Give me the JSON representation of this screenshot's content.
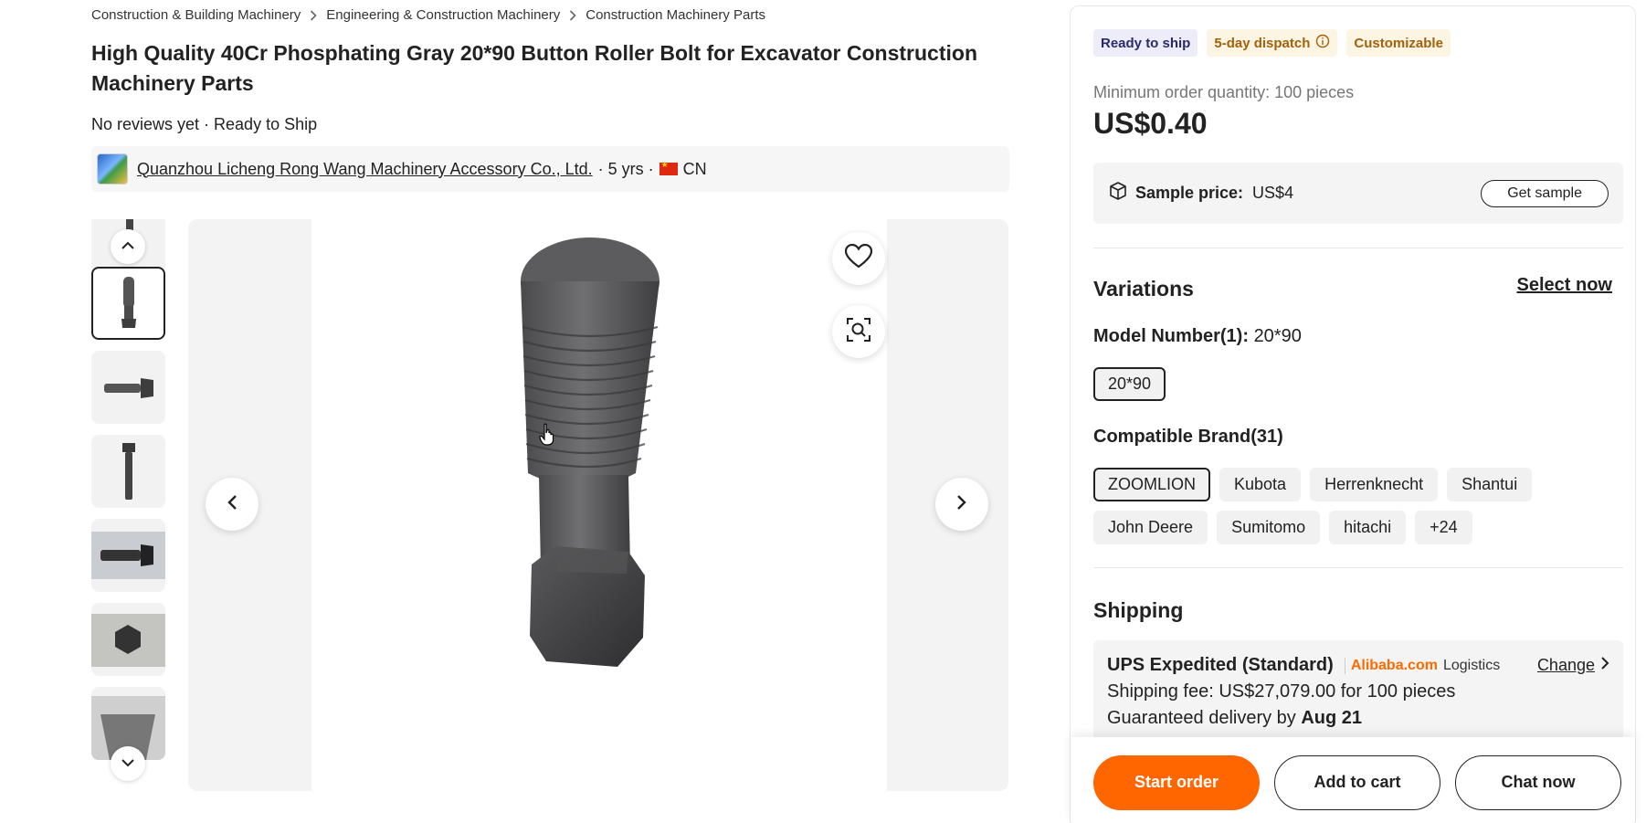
{
  "breadcrumb": [
    {
      "label": "Construction & Building Machinery"
    },
    {
      "label": "Engineering & Construction Machinery"
    },
    {
      "label": "Construction Machinery Parts"
    }
  ],
  "product": {
    "title": "High Quality 40Cr Phosphating Gray 20*90 Button Roller Bolt for Excavator Construction Machinery Parts",
    "review_line": "No reviews yet · Ready to Ship"
  },
  "supplier": {
    "name": "Quanzhou Licheng Rong Wang Machinery Accessory Co., Ltd.",
    "years": "· 5 yrs ·",
    "country": "CN"
  },
  "gallery": {
    "thumb_count": 6,
    "active_index": 1
  },
  "badges": {
    "ready": "Ready to ship",
    "dispatch": "5-day dispatch",
    "customizable": "Customizable"
  },
  "pricing": {
    "moq": "Minimum order quantity: 100 pieces",
    "price": "US$0.40",
    "sample_label": "Sample price:",
    "sample_price": "US$4",
    "sample_button": "Get sample"
  },
  "variations": {
    "title": "Variations",
    "select_now": "Select now",
    "model_label": "Model Number(1):",
    "model_value": "20*90",
    "models": [
      "20*90"
    ],
    "brand_label": "Compatible Brand(31)",
    "brands": [
      "ZOOMLION",
      "Kubota",
      "Herrenknecht",
      "Shantui",
      "John Deere",
      "Sumitomo",
      "hitachi",
      "+24"
    ]
  },
  "shipping": {
    "title": "Shipping",
    "method": "UPS Expedited (Standard)",
    "logo": "Alibaba.com",
    "logo_sub": "Logistics",
    "change": "Change",
    "fee": "Shipping fee: US$27,079.00 for 100 pieces",
    "delivery_prefix": "Guaranteed delivery by",
    "delivery_date": "Aug 21"
  },
  "actions": {
    "start_order": "Start order",
    "add_to_cart": "Add to cart",
    "chat_now": "Chat now"
  },
  "colors": {
    "accent": "#ff6600",
    "dispatch_text": "#a3610a",
    "ready_bg": "#ededfa"
  }
}
